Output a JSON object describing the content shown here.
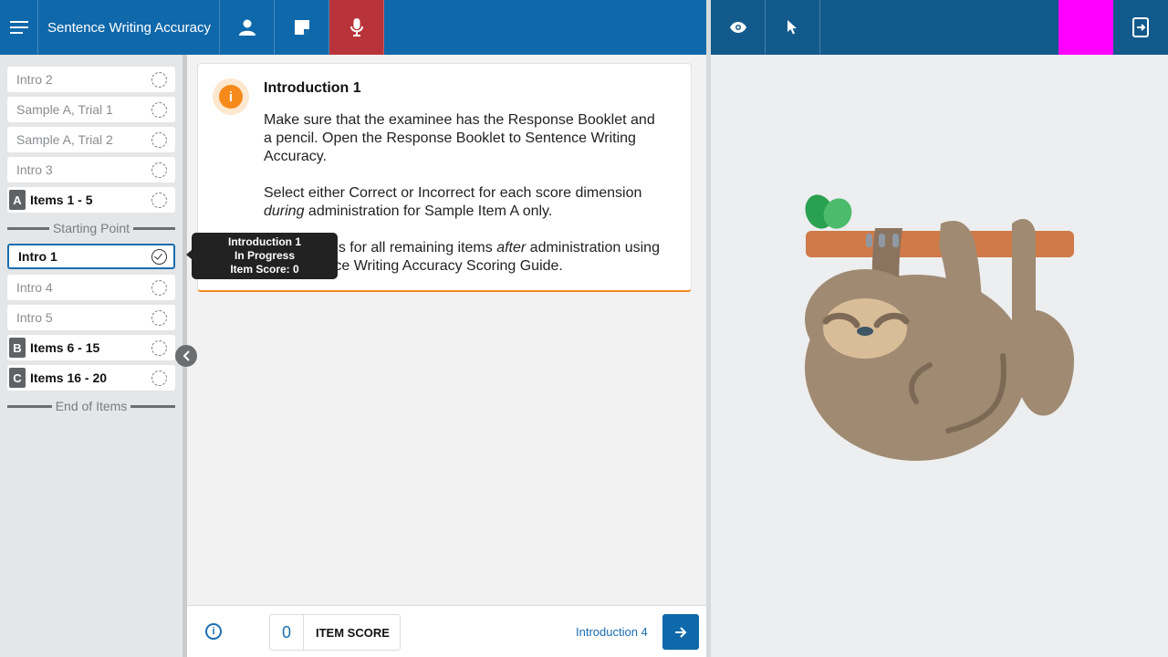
{
  "header": {
    "title": "Sentence Writing Accuracy"
  },
  "sidebar": {
    "items": [
      {
        "label": "Intro 2"
      },
      {
        "label": "Sample A, Trial 1"
      },
      {
        "label": "Sample A, Trial 2"
      },
      {
        "label": "Intro 3"
      },
      {
        "letter": "A",
        "label": "Items 1 - 5"
      },
      {
        "label": "Intro 1"
      },
      {
        "label": "Intro 4"
      },
      {
        "label": "Intro 5"
      },
      {
        "letter": "B",
        "label": "Items 6 - 15"
      },
      {
        "letter": "C",
        "label": "Items 16 - 20"
      }
    ],
    "starting_point": "Starting Point",
    "end_of_items": "End of Items"
  },
  "tooltip": {
    "line1": "Introduction 1",
    "line2": "In Progress",
    "line3": "Item Score: 0"
  },
  "card": {
    "title": "Introduction 1",
    "para1": "Make sure that the examinee has the Response Booklet and a pencil. Open the Response Booklet to Sentence Writing Accuracy.",
    "para2_a": "Select either Correct or Incorrect for each score dimension ",
    "para2_em": "during",
    "para2_b": " administration for Sample Item A only.",
    "para3_a": "Enter scores for all remaining items ",
    "para3_em": "after",
    "para3_b": " administration using the Sentence Writing Accuracy Scoring Guide."
  },
  "footer": {
    "item_score_value": "0",
    "item_score_label": "ITEM SCORE",
    "next_label": "Introduction 4"
  },
  "colors": {
    "topbar": "#0f68aa",
    "topbar_right": "#125a8c",
    "mic_active": "#b8343a",
    "magenta": "#ff00ff",
    "accent_orange": "#f58a1a"
  }
}
